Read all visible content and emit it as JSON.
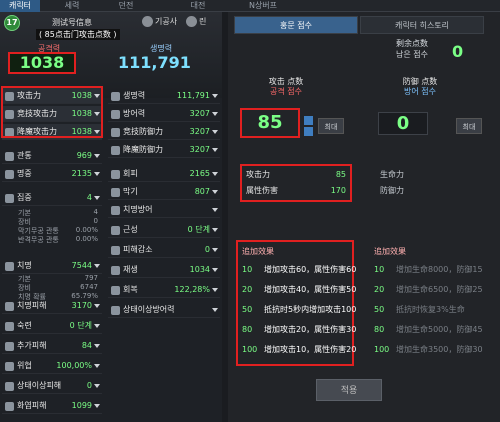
{
  "top_tabs": [
    "캐릭터",
    "세력",
    "던전",
    "대전",
    "N상버프"
  ],
  "header": {
    "level": "17",
    "char_name": "测试号信息",
    "sub_name": "( 85点击门攻击点数 )",
    "chips": [
      "기공사",
      "린"
    ],
    "attack_label": "공격력",
    "attack_value": "1038",
    "hp_label": "생명력",
    "hp_value": "111,791"
  },
  "left_stats": [
    {
      "label": "攻击力",
      "value": "1038",
      "icon": "sword-icon"
    },
    {
      "label": "竞技攻击力",
      "value": "1038",
      "icon": "arena-sword-icon"
    },
    {
      "label": "降魔攻击力",
      "value": "1038",
      "icon": "demon-sword-icon"
    },
    {
      "label": "관통",
      "value": "969",
      "icon": "pierce-icon"
    },
    {
      "label": "명중",
      "value": "2135",
      "icon": "accuracy-icon"
    },
    {
      "label": "집중",
      "value": "4",
      "icon": "focus-icon"
    },
    {
      "label": "치명",
      "value": "7544",
      "icon": "crit-icon"
    },
    {
      "label": "치명피해",
      "value": "3170",
      "icon": "crit-damage-icon"
    },
    {
      "label": "숙련",
      "value": "0 단계",
      "icon": "mastery-icon"
    },
    {
      "label": "추가피해",
      "value": "84",
      "icon": "extra-damage-icon"
    },
    {
      "label": "위협",
      "value": "100,00%",
      "icon": "threat-icon"
    },
    {
      "label": "상태이상피해",
      "value": "0",
      "icon": "status-damage-icon"
    },
    {
      "label": "화염피해",
      "value": "1099",
      "icon": "fire-icon"
    }
  ],
  "focus_sub": [
    {
      "label": "기본",
      "value": "4"
    },
    {
      "label": "장비",
      "value": "0"
    },
    {
      "label": "막기무공 관통",
      "value": "0.00%"
    },
    {
      "label": "반격무공 관통",
      "value": "0.00%"
    }
  ],
  "crit_sub": [
    {
      "label": "기본",
      "value": "797"
    },
    {
      "label": "장비",
      "value": "6747"
    },
    {
      "label": "치명 확률",
      "value": "65.79%"
    }
  ],
  "right_stats": [
    {
      "label": "생명력",
      "value": "111,791",
      "icon": "heart-icon"
    },
    {
      "label": "방어력",
      "value": "3207",
      "icon": "shield-icon"
    },
    {
      "label": "竞技防御力",
      "value": "3207",
      "icon": "arena-shield-icon"
    },
    {
      "label": "降魔防御力",
      "value": "3207",
      "icon": "demon-shield-icon"
    },
    {
      "label": "회피",
      "value": "2165",
      "icon": "evade-icon"
    },
    {
      "label": "막기",
      "value": "807",
      "icon": "block-icon"
    },
    {
      "label": "치명방어",
      "value": "",
      "icon": "crit-defense-icon"
    },
    {
      "label": "근성",
      "value": "0 단계",
      "icon": "grit-icon"
    },
    {
      "label": "피해감소",
      "value": "0",
      "icon": "damage-reduce-icon"
    },
    {
      "label": "재생",
      "value": "1034",
      "icon": "regen-icon"
    },
    {
      "label": "회복",
      "value": "122,28%",
      "icon": "recovery-icon"
    },
    {
      "label": "상태이상방어력",
      "value": "",
      "icon": "status-defense-icon"
    }
  ],
  "right_panel": {
    "tabs": [
      "홍문 점수",
      "캐릭터 히스토리"
    ],
    "remain_label_1": "剩余点数",
    "remain_label_2": "남은 점수",
    "remain_value": "0",
    "attack_points_label": "攻击 点数",
    "attack_points_label_kr": "공격 점수",
    "attack_points_value": "85",
    "defense_points_label": "防御 点数",
    "defense_points_label_kr": "방어 점수",
    "defense_points_value": "0",
    "max_label": "최대",
    "attack_stats": [
      {
        "label": "攻击力",
        "value": "85"
      },
      {
        "label": "属性伤害",
        "value": "170"
      }
    ],
    "defense_stats": [
      {
        "label": "生命力",
        "value": ""
      },
      {
        "label": "防御力",
        "value": ""
      }
    ],
    "extra_title": "追加效果",
    "attack_effects": [
      {
        "n": "10",
        "text": "增加攻击60，属性伤害60"
      },
      {
        "n": "20",
        "text": "增加攻击40，属性伤害50"
      },
      {
        "n": "50",
        "text": "抵抗时5秒内增加攻击100"
      },
      {
        "n": "80",
        "text": "增加攻击20，属性伤害30"
      },
      {
        "n": "100",
        "text": "增加攻击10，属性伤害20"
      }
    ],
    "defense_effects": [
      {
        "n": "10",
        "text": "增加生命8000，防御15"
      },
      {
        "n": "20",
        "text": "增加生命6500，防御25"
      },
      {
        "n": "50",
        "text": "抵抗时恢复3%生命"
      },
      {
        "n": "80",
        "text": "增加生命5000，防御45"
      },
      {
        "n": "100",
        "text": "增加生命3500，防御30"
      }
    ],
    "apply_label": "적용"
  },
  "colors": {
    "accent_green": "#7bff86",
    "highlight_red": "#e02020",
    "tab_blue": "#39628d"
  }
}
